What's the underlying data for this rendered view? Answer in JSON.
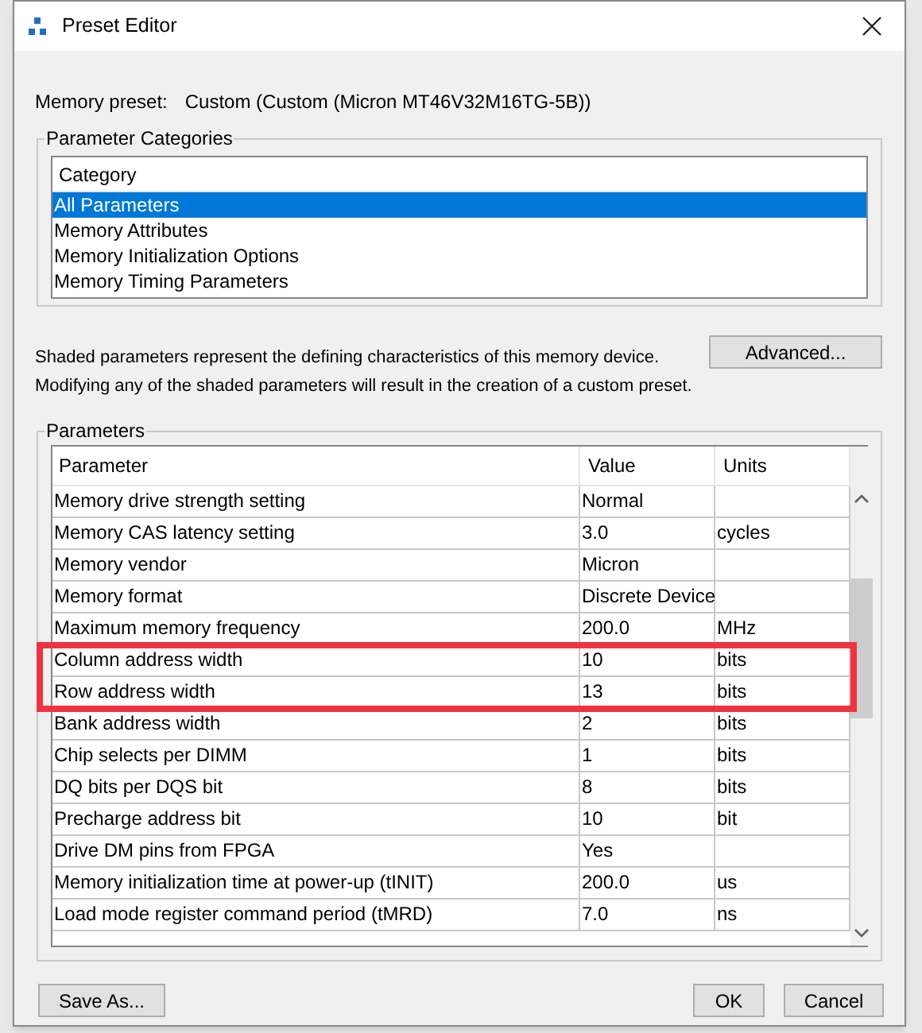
{
  "window": {
    "title": "Preset Editor"
  },
  "memory_preset": {
    "label": "Memory preset:",
    "value": "Custom (Custom (Micron MT46V32M16TG-5B))"
  },
  "categories": {
    "title": "Parameter Categories",
    "column": "Category",
    "items": [
      {
        "label": "All Parameters",
        "selected": true
      },
      {
        "label": "Memory Attributes",
        "selected": false
      },
      {
        "label": "Memory Initialization Options",
        "selected": false
      },
      {
        "label": "Memory Timing Parameters",
        "selected": false
      }
    ]
  },
  "notes": [
    "Shaded parameters represent the defining characteristics of this memory device.",
    "Modifying any of the shaded parameters will result in the creation of a custom preset."
  ],
  "advanced_button": "Advanced...",
  "parameters": {
    "title": "Parameters",
    "columns": [
      "Parameter",
      "Value",
      "Units"
    ],
    "rows": [
      {
        "parameter": "Memory drive strength setting",
        "value": "Normal",
        "highlighted": false
      },
      {
        "parameter": "Memory CAS latency setting",
        "value": "3.0",
        "units": "cycles",
        "highlighted": false
      },
      {
        "parameter": "Memory vendor",
        "value": "Micron",
        "highlighted": false
      },
      {
        "parameter": "Memory format",
        "value": "Discrete Device",
        "highlighted": false
      },
      {
        "parameter": "Maximum memory frequency",
        "value": "200.0",
        "units": "MHz",
        "highlighted": false
      },
      {
        "parameter": "Column address width",
        "value": "10",
        "units": "bits",
        "highlighted": true
      },
      {
        "parameter": "Row address width",
        "value": "13",
        "units": "bits",
        "highlighted": true
      },
      {
        "parameter": "Bank address width",
        "value": "2",
        "units": "bits",
        "highlighted": false
      },
      {
        "parameter": "Chip selects per DIMM",
        "value": "1",
        "units": "bits",
        "highlighted": false
      },
      {
        "parameter": "DQ bits per DQS bit",
        "value": "8",
        "units": "bits",
        "highlighted": false
      },
      {
        "parameter": "Precharge address bit",
        "value": "10",
        "units": "bit",
        "highlighted": false
      },
      {
        "parameter": "Drive DM pins from FPGA",
        "value": "Yes",
        "highlighted": false
      },
      {
        "parameter": "Memory initialization time at power-up (tINIT)",
        "value": "200.0",
        "units": "us",
        "highlighted": false
      },
      {
        "parameter": "Load mode register command period (tMRD)",
        "value": "7.0",
        "units": "ns",
        "highlighted": false
      }
    ]
  },
  "buttons": {
    "save_as": "Save As...",
    "ok": "OK",
    "cancel": "Cancel"
  }
}
